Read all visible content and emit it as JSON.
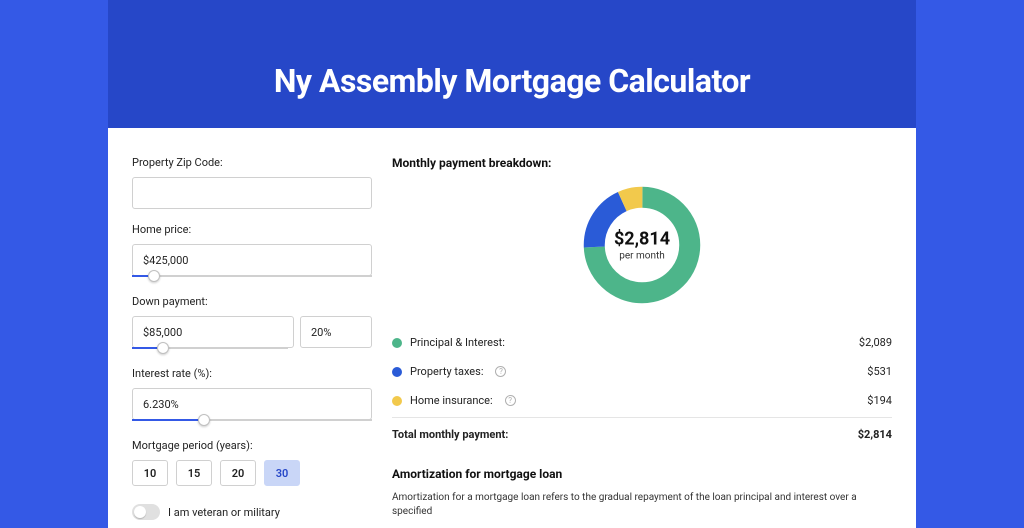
{
  "title": "Ny Assembly Mortgage Calculator",
  "colors": {
    "principal": "#4db58a",
    "tax": "#2a5bd7",
    "insurance": "#f2c94c"
  },
  "form": {
    "zip": {
      "label": "Property Zip Code:",
      "value": ""
    },
    "home_price": {
      "label": "Home price:",
      "value": "$425,000",
      "slider_pct": 9
    },
    "down_payment": {
      "label": "Down payment:",
      "amount": "$85,000",
      "percent": "20%",
      "slider_pct": 20
    },
    "interest_rate": {
      "label": "Interest rate (%):",
      "value": "6.230%",
      "slider_pct": 30
    },
    "mortgage_period": {
      "label": "Mortgage period (years):",
      "options": [
        "10",
        "15",
        "20",
        "30"
      ],
      "selected": "30"
    },
    "veteran": {
      "label": "I am veteran or military",
      "on": false
    }
  },
  "breakdown": {
    "title": "Monthly payment breakdown:",
    "center_amount": "$2,814",
    "center_sub": "per month",
    "rows": [
      {
        "key": "principal_interest",
        "label": "Principal & Interest:",
        "value": "$2,089",
        "color": "principal",
        "info": false
      },
      {
        "key": "property_taxes",
        "label": "Property taxes:",
        "value": "$531",
        "color": "tax",
        "info": true
      },
      {
        "key": "home_insurance",
        "label": "Home insurance:",
        "value": "$194",
        "color": "insurance",
        "info": true
      }
    ],
    "total": {
      "label": "Total monthly payment:",
      "value": "$2,814"
    }
  },
  "chart_data": {
    "type": "pie",
    "title": "Monthly payment breakdown",
    "series": [
      {
        "name": "Principal & Interest",
        "value": 2089
      },
      {
        "name": "Property taxes",
        "value": 531
      },
      {
        "name": "Home insurance",
        "value": 194
      }
    ],
    "total": 2814
  },
  "amortization": {
    "title": "Amortization for mortgage loan",
    "text": "Amortization for a mortgage loan refers to the gradual repayment of the loan principal and interest over a specified"
  }
}
